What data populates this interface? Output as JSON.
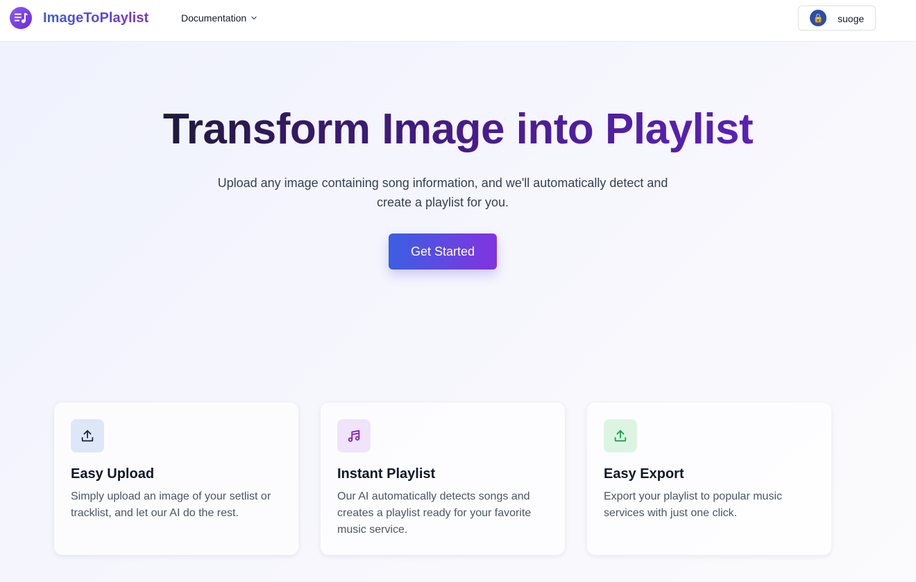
{
  "header": {
    "brand": "ImageToPlaylist",
    "logo_icon": "music-list-icon",
    "nav": {
      "documentation_label": "Documentation"
    },
    "user": {
      "avatar_emoji": "🔒",
      "name": "suoge"
    }
  },
  "hero": {
    "title": "Transform Image into Playlist",
    "subtitle": "Upload any image containing song information, and we'll automatically detect and create a playlist for you.",
    "cta_label": "Get Started"
  },
  "features": [
    {
      "icon": "upload-icon",
      "title": "Easy Upload",
      "description": "Simply upload an image of your setlist or tracklist, and let our AI do the rest.",
      "icon_bg": "#dde7f7",
      "icon_color": "#1f2937"
    },
    {
      "icon": "music-note-icon",
      "title": "Instant Playlist",
      "description": "Our AI automatically detects songs and creates a playlist ready for your favorite music service.",
      "icon_bg": "#efe4fb",
      "icon_color": "#7e22ce"
    },
    {
      "icon": "export-icon",
      "title": "Easy Export",
      "description": "Export your playlist to popular music services with just one click.",
      "icon_bg": "#dcf5e3",
      "icon_color": "#16a34a"
    }
  ],
  "colors": {
    "brand_gradient_start": "#3b5fe0",
    "brand_gradient_end": "#7a2fe0",
    "cta_gradient_start": "#3b5fe3",
    "cta_gradient_end": "#8233e0"
  }
}
